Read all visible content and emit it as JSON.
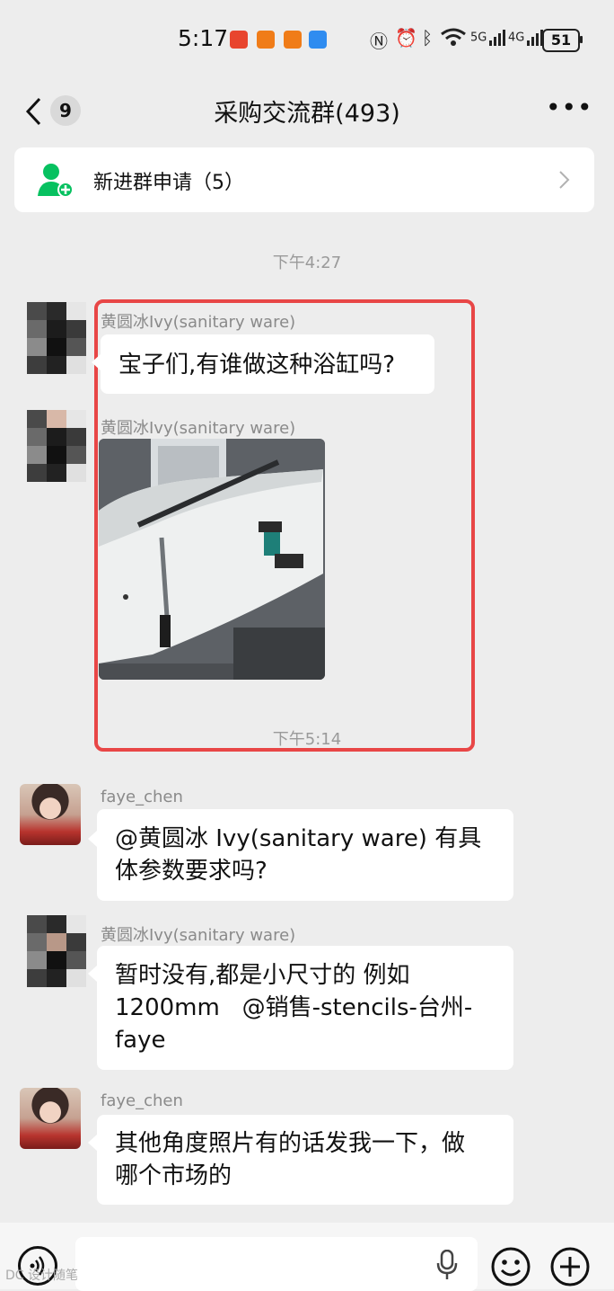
{
  "status_bar": {
    "time": "5:17",
    "battery": "51",
    "network_5g": "5G",
    "network_4g": "4G"
  },
  "header": {
    "unread_count": "9",
    "title": "采购交流群(493)",
    "more_label": "•••"
  },
  "join_request": {
    "label": "新进群申请（5）"
  },
  "times": {
    "t1": "下午4:27",
    "t2": "下午5:14"
  },
  "messages": [
    {
      "sender": "黄圆冰Ivy(sanitary ware)",
      "text": "宝子们,有谁做这种浴缸吗?"
    },
    {
      "sender": "黄圆冰Ivy(sanitary ware)",
      "type": "image"
    },
    {
      "sender": "faye_chen",
      "text_line1": "@黄圆冰 Ivy(sanitary ware) 有具",
      "text_line2": "体参数要求吗?"
    },
    {
      "sender": "黄圆冰Ivy(sanitary ware)",
      "text_line1": "暂时没有,都是小尺寸的 例如",
      "text_line2": "1200mm   @销售-stencils-台州-",
      "text_line3": "faye"
    },
    {
      "sender": "faye_chen",
      "text_line1": "其他角度照片有的话发我一下，做",
      "text_line2": "哪个市场的"
    }
  ],
  "input_bar": {
    "placeholder": ""
  },
  "watermark": "DC 设计随笔",
  "colors": {
    "background": "#ededed",
    "accent_green": "#07c160",
    "highlight_red": "#e84646"
  }
}
